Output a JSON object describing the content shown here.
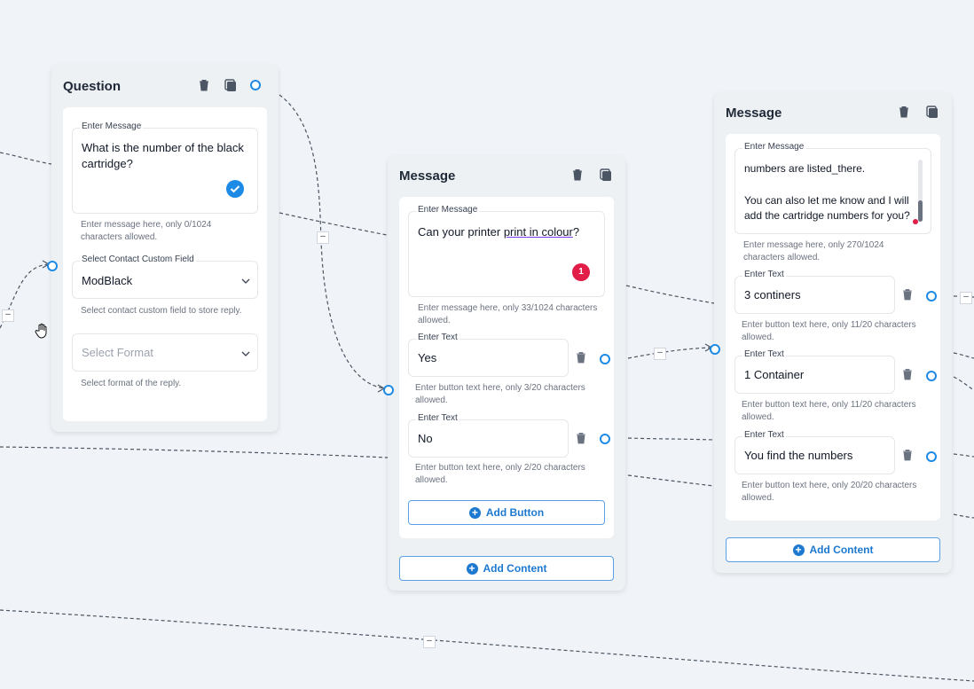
{
  "question_node": {
    "title": "Question",
    "message_label": "Enter Message",
    "message_text": "What is the number of the black cartridge?",
    "message_hint": "Enter message here, only 0/1024 characters allowed.",
    "custom_field_label": "Select Contact Custom Field",
    "custom_field_value": "ModBlack",
    "custom_field_hint": "Select contact custom field to store reply.",
    "format_placeholder": "Select Format",
    "format_hint": "Select format of the reply."
  },
  "message_node_1": {
    "title": "Message",
    "message_label": "Enter Message",
    "message_text_plain": "Can your printer ",
    "message_text_underlined": "print in colour",
    "message_text_end": "?",
    "error_badge": "1",
    "message_hint": "Enter message here, only 33/1024 characters allowed.",
    "buttons": [
      {
        "label": "Enter Text",
        "value": "Yes",
        "hint": "Enter button text here, only 3/20 characters allowed."
      },
      {
        "label": "Enter Text",
        "value": "No",
        "hint": "Enter button text here, only 2/20 characters allowed."
      }
    ],
    "add_button_label": "Add Button",
    "add_content_label": "Add Content"
  },
  "message_node_2": {
    "title": "Message",
    "message_label": "Enter Message",
    "message_line1": "numbers are listed_there.",
    "message_line2": "You can also let me know and I will",
    "message_line3": "add the cartridge numbers for you?",
    "message_hint": "Enter message here, only 270/1024 characters allowed.",
    "buttons": [
      {
        "label": "Enter Text",
        "value": "3 continers",
        "hint": "Enter button text here, only 11/20 characters allowed."
      },
      {
        "label": "Enter Text",
        "value": "1 Container",
        "hint": "Enter button text here, only 11/20 characters allowed."
      },
      {
        "label": "Enter Text",
        "value": "You find the numbers",
        "hint": "Enter button text here, only 20/20 characters allowed."
      }
    ],
    "add_content_label": "Add Content"
  },
  "colors": {
    "accent": "#1d8ae5",
    "error": "#e11d48",
    "background": "#f0f4f8"
  }
}
